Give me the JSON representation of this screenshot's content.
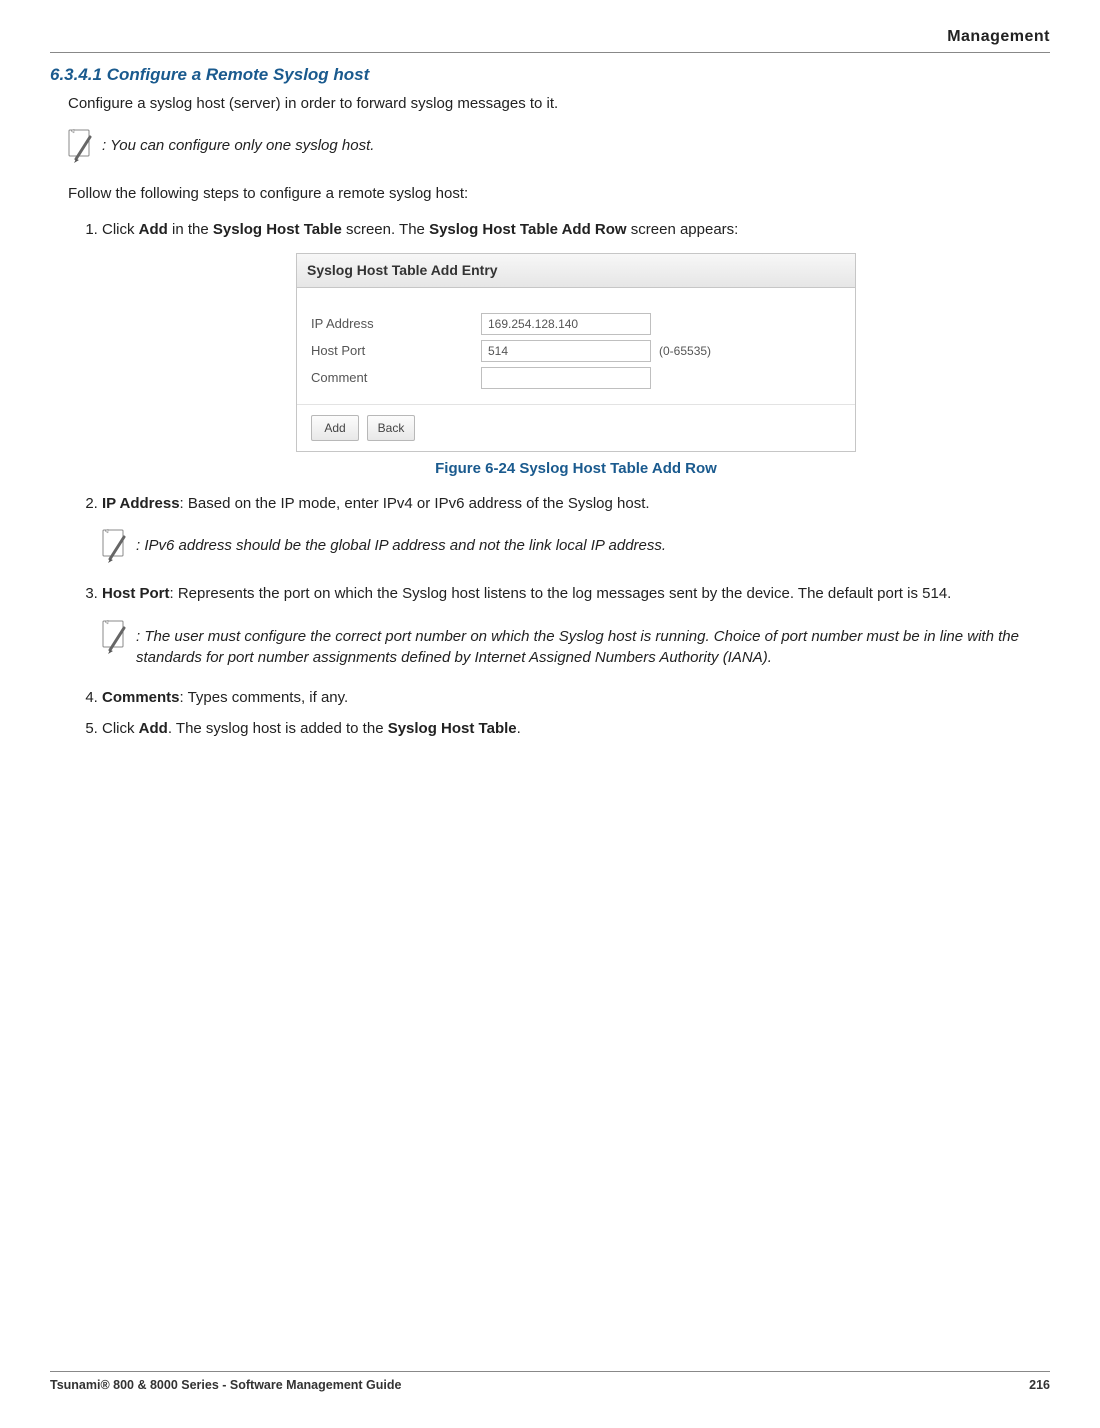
{
  "header": {
    "category": "Management"
  },
  "section": {
    "number_title": "6.3.4.1 Configure a Remote Syslog host",
    "intro": "Configure a syslog host (server) in order to forward syslog messages to it.",
    "note_single_host": ": You can configure only one syslog host.",
    "follow_steps": "Follow the following steps to configure a remote syslog host:"
  },
  "steps": {
    "s1_a": "Click ",
    "s1_b": "Add",
    "s1_c": " in the ",
    "s1_d": "Syslog Host Table",
    "s1_e": " screen. The ",
    "s1_f": "Syslog Host Table Add Row",
    "s1_g": " screen appears:",
    "s2_a": "IP Address",
    "s2_b": ": Based on the IP mode, enter IPv4 or IPv6 address of the Syslog host.",
    "note_ipv6": ": IPv6 address should be the global IP address and not the link local IP address.",
    "s3_a": "Host Port",
    "s3_b": ": Represents the port on which the Syslog host listens to the log messages sent by the device. The default port is 514.",
    "note_port": ": The user must configure the correct port number on which the Syslog host is running. Choice of port number must be in line with the standards for port number assignments defined by Internet Assigned Numbers Authority (IANA).",
    "s4_a": "Comments",
    "s4_b": ": Types comments, if any.",
    "s5_a": "Click ",
    "s5_b": "Add",
    "s5_c": ". The syslog host is added to the ",
    "s5_d": "Syslog Host Table",
    "s5_e": "."
  },
  "dialog": {
    "title": "Syslog Host Table Add Entry",
    "rows": {
      "ip_label": "IP Address",
      "ip_value": "169.254.128.140",
      "port_label": "Host Port",
      "port_value": "514",
      "port_hint": "(0-65535)",
      "comment_label": "Comment",
      "comment_value": ""
    },
    "buttons": {
      "add": "Add",
      "back": "Back"
    }
  },
  "figure_caption": "Figure 6-24 Syslog Host Table Add Row",
  "footer": {
    "left": "Tsunami® 800 & 8000 Series - Software Management Guide",
    "right": "216"
  }
}
